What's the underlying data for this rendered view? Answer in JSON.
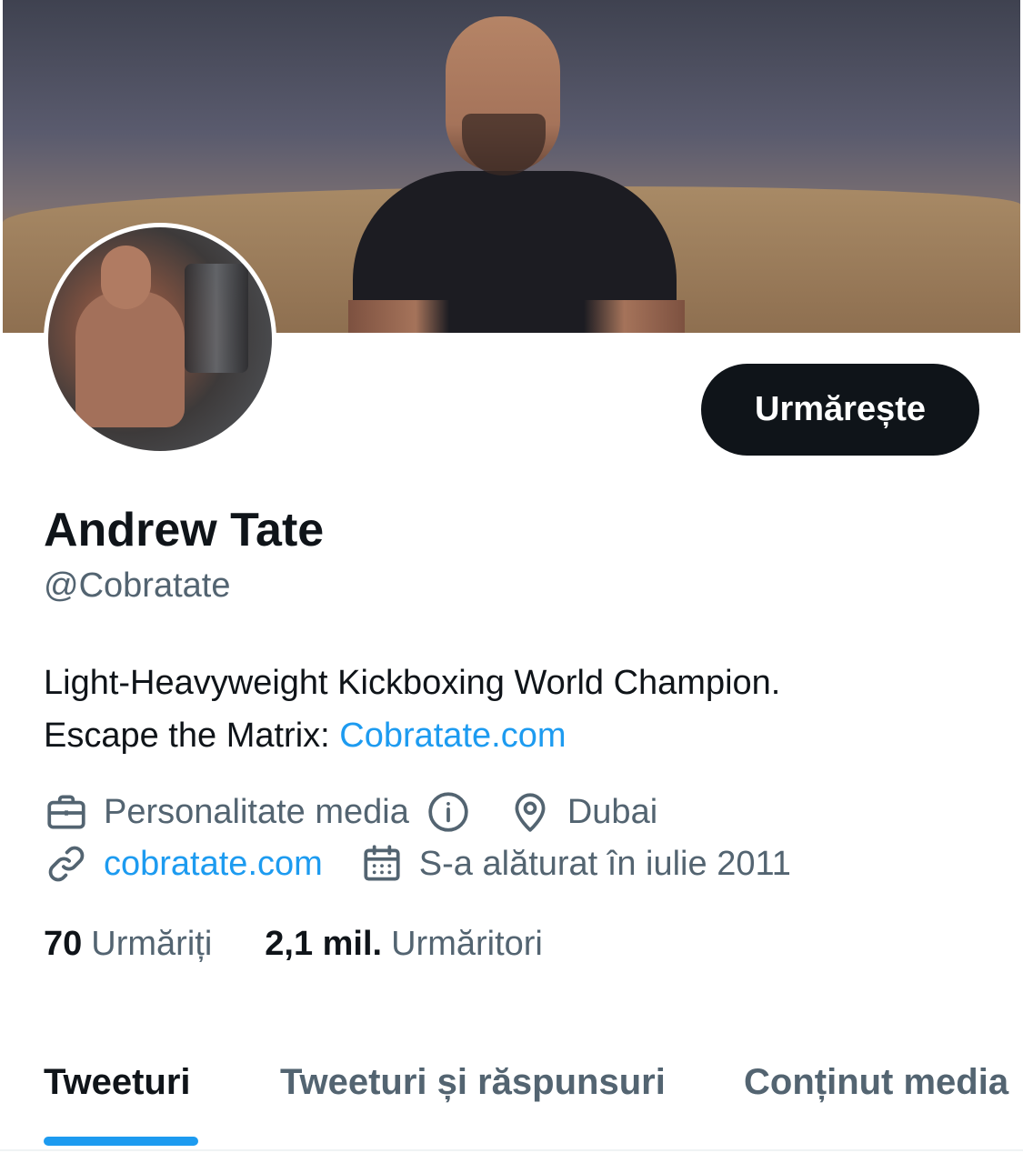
{
  "profile": {
    "name": "Andrew Tate",
    "handle": "@Cobratate",
    "follow_label": "Urmărește",
    "bio_line1": "Light-Heavyweight Kickboxing World Champion.",
    "bio_line2_prefix": "Escape the Matrix:",
    "bio_link": "Cobratate.com",
    "category": "Personalitate media",
    "location": "Dubai",
    "website": "cobratate.com",
    "joined": "S-a alăturat în iulie 2011",
    "following_count": "70",
    "following_label": "Urmăriți",
    "followers_count": "2,1 mil.",
    "followers_label": "Urmăritori"
  },
  "tabs": [
    {
      "label": "Tweeturi",
      "active": true
    },
    {
      "label": "Tweeturi și răspunsuri",
      "active": false
    },
    {
      "label": "Conținut media",
      "active": false
    }
  ],
  "icons": {
    "category": "briefcase-icon",
    "info": "info-icon",
    "location": "location-pin-icon",
    "website": "link-icon",
    "joined": "calendar-icon"
  },
  "colors": {
    "accent": "#1d9bf0",
    "text_primary": "#0f1419",
    "text_secondary": "#536471",
    "button_bg": "#0f1419"
  }
}
